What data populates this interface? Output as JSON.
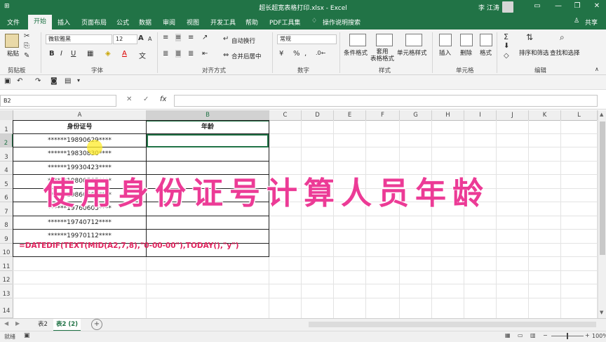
{
  "window": {
    "title": "超长超宽表格打印.xlsx - Excel",
    "user": "李 江涛",
    "controls": [
      "▭",
      "—",
      "❐",
      "✕"
    ]
  },
  "ribbon_tabs": [
    "文件",
    "开始",
    "插入",
    "页面布局",
    "公式",
    "数据",
    "审阅",
    "视图",
    "开发工具",
    "帮助",
    "PDF工具集",
    "操作说明搜索"
  ],
  "share": "共享",
  "ribbon": {
    "clipboard": {
      "paste": "粘贴",
      "label": "剪贴板"
    },
    "font": {
      "name": "微软雅黑",
      "size": "12",
      "label": "字体",
      "bold": "B",
      "italic": "I",
      "underline": "U",
      "grow": "A",
      "shrink": "A"
    },
    "alignment": {
      "wrap": "自动换行",
      "merge": "合并后居中",
      "label": "对齐方式"
    },
    "number": {
      "format": "常规",
      "percent": "%",
      "comma": ",",
      "label": "数字"
    },
    "styles": {
      "conditional": "条件格式",
      "table": "套用\n表格格式",
      "cell": "单元格样式",
      "label": "样式"
    },
    "cells": {
      "insert": "插入",
      "delete": "删除",
      "format": "格式",
      "label": "单元格"
    },
    "editing": {
      "sort": "排序和筛选",
      "find": "查找和选择",
      "label": "编辑"
    }
  },
  "formula_bar": {
    "name_box": "B2",
    "cancel": "✕",
    "enter": "✓",
    "fx": "fx",
    "value": ""
  },
  "columns": [
    "A",
    "B",
    "C",
    "D",
    "E",
    "F",
    "G",
    "H",
    "I",
    "J",
    "K",
    "L"
  ],
  "rows": [
    "1",
    "2",
    "3",
    "4",
    "5",
    "6",
    "7",
    "8",
    "9",
    "10",
    "11",
    "12",
    "13",
    "14"
  ],
  "table": {
    "header_a": "身份证号",
    "header_b": "年龄",
    "ids": [
      "******19890629****",
      "******19830830****",
      "******19930423****",
      "******19800505****",
      "******19860603****",
      "******19760605****",
      "******19740712****",
      "******19970112****"
    ]
  },
  "formula_text": "=DATEDIF(TEXT(MID(A2,7,8),\"0-00-00\"),TODAY(),\"y\")",
  "banner": "使用身份证号计算人员年龄",
  "sheets": [
    "表2",
    "表2 (2)"
  ],
  "add_sheet": "+",
  "status": {
    "ready": "就绪",
    "zoom": "100%"
  }
}
